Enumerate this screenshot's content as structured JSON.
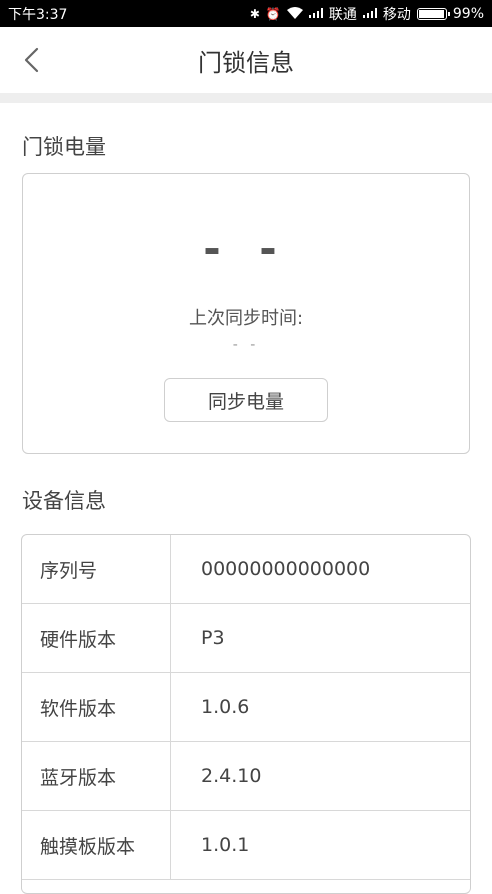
{
  "status_bar": {
    "time": "下午3:37",
    "carrier1": "联通",
    "carrier2": "移动",
    "battery_percent": "99%",
    "battery_fraction": 0.99
  },
  "navbar": {
    "title": "门锁信息",
    "back_icon": "chevron-left-icon"
  },
  "battery_section": {
    "title": "门锁电量",
    "level": "- -",
    "sync_label": "上次同步时间:",
    "sync_time": "- -",
    "sync_button": "同步电量"
  },
  "device_section": {
    "title": "设备信息",
    "rows": [
      {
        "key": "序列号",
        "value": "00000000000000"
      },
      {
        "key": "硬件版本",
        "value": "P3"
      },
      {
        "key": "软件版本",
        "value": "1.0.6"
      },
      {
        "key": "蓝牙版本",
        "value": "2.4.10"
      },
      {
        "key": "触摸板版本",
        "value": "1.0.1"
      }
    ]
  },
  "colors": {
    "border": "#cfcfcf",
    "band": "#eeeeee",
    "text": "#444444"
  }
}
